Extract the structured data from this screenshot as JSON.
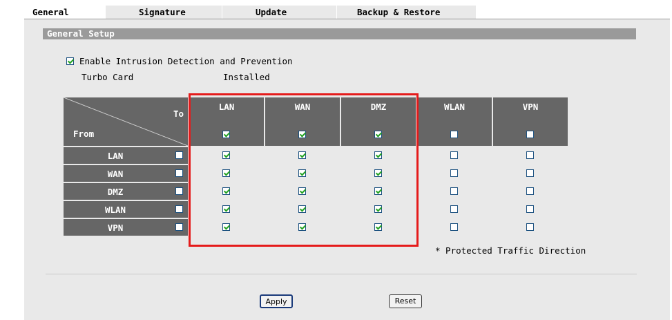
{
  "tabs": [
    "General",
    "Signature",
    "Update",
    "Backup & Restore"
  ],
  "section_title": "General Setup",
  "enable_ids": {
    "label": "Enable Intrusion Detection and Prevention",
    "checked": true
  },
  "turbo_card": {
    "label": "Turbo Card",
    "value": "Installed"
  },
  "matrix": {
    "to_label": "To",
    "from_label": "From",
    "columns": [
      {
        "name": "LAN",
        "checked": true
      },
      {
        "name": "WAN",
        "checked": true
      },
      {
        "name": "DMZ",
        "checked": true
      },
      {
        "name": "WLAN",
        "checked": false
      },
      {
        "name": "VPN",
        "checked": false
      }
    ],
    "rows": [
      {
        "name": "LAN",
        "row_checked": false,
        "cells": [
          true,
          true,
          true,
          false,
          false
        ]
      },
      {
        "name": "WAN",
        "row_checked": false,
        "cells": [
          true,
          true,
          true,
          false,
          false
        ]
      },
      {
        "name": "DMZ",
        "row_checked": false,
        "cells": [
          true,
          true,
          true,
          false,
          false
        ]
      },
      {
        "name": "WLAN",
        "row_checked": false,
        "cells": [
          true,
          true,
          true,
          false,
          false
        ]
      },
      {
        "name": "VPN",
        "row_checked": false,
        "cells": [
          true,
          true,
          true,
          false,
          false
        ]
      }
    ]
  },
  "note": "* Protected Traffic Direction",
  "buttons": {
    "apply": "Apply",
    "reset": "Reset"
  },
  "colors": {
    "header_bg": "#666666",
    "highlight": "#e51b1b",
    "check": "#21a121"
  }
}
